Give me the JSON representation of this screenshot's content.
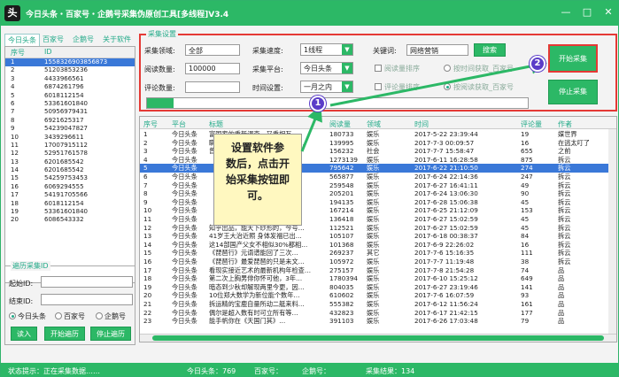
{
  "window": {
    "icon_glyph": "头",
    "title": "今日头条・百家号・企鹅号采集伪原创工具[多线程]V3.4",
    "min_glyph": "—",
    "max_glyph": "□",
    "close_glyph": "✕"
  },
  "left": {
    "tabs": [
      "今日头条",
      "百家号",
      "企鹅号",
      "关于软件"
    ],
    "list_headers": [
      "序号",
      "ID"
    ],
    "rows": [
      [
        "1",
        "1558326903856873"
      ],
      [
        "2",
        "51203853236"
      ],
      [
        "3",
        "4433966561"
      ],
      [
        "4",
        "6874261796"
      ],
      [
        "5",
        "6018112154"
      ],
      [
        "6",
        "53361601840"
      ],
      [
        "7",
        "50956979431"
      ],
      [
        "8",
        "6921625317"
      ],
      [
        "9",
        "54239047827"
      ],
      [
        "10",
        "3439296611"
      ],
      [
        "11",
        "17007915112"
      ],
      [
        "12",
        "52951761578"
      ],
      [
        "13",
        "6201685542"
      ],
      [
        "14",
        "6201685542"
      ],
      [
        "15",
        "54259753453"
      ],
      [
        "16",
        "6069294555"
      ],
      [
        "17",
        "54191705566"
      ],
      [
        "18",
        "6018112154"
      ],
      [
        "19",
        "53361601840"
      ],
      [
        "20",
        "6086543332"
      ]
    ],
    "history": {
      "legend": "遍历采集ID",
      "start_label": "起始ID:",
      "end_label": "结束ID:",
      "platforms": [
        "今日头条",
        "百家号",
        "企鹅号"
      ],
      "buttons": [
        "读入",
        "开始遍历",
        "停止遍历"
      ]
    }
  },
  "settings": {
    "legend": "采集设置",
    "domain_label": "采集领域:",
    "domain_value": "全部",
    "speed_label": "采集速度:",
    "speed_value": "1线程",
    "keyword_label": "关键词:",
    "keyword_value": "网络营销",
    "search_label": "搜索",
    "read_label": "阅读数量:",
    "read_value": "100000",
    "platform_label": "采集平台:",
    "platform_value": "今日头条",
    "comment_label": "评论数量:",
    "comment_value": "",
    "time_label": "时间设置:",
    "time_value": "一月之内",
    "opt_read_sort": "阅读量排序",
    "opt_comment_sort": "评论量排序",
    "opt_by_time": "按时间获取_百家号",
    "opt_by_follow": "按阅读获取_百家号",
    "start_label": "开始采集",
    "stop_label": "停止采集",
    "progress": 0.07
  },
  "table": {
    "headers": [
      "序号",
      "平台",
      "标题",
      "阅读量",
      "领域",
      "时间",
      "评论量",
      "作者"
    ],
    "rows": [
      [
        "1",
        "今日头条",
        "富国家的重新调查，又重相互…",
        "180733",
        "娱乐",
        "2017-5-22 23:39:44",
        "19",
        "媒世界"
      ],
      [
        "2",
        "今日头条",
        "瞒着把所有家族的人都找回来了…",
        "139995",
        "娱乐",
        "2017-7-3 00:09:57",
        "16",
        "在逃太叮了"
      ],
      [
        "3",
        "今日头条",
        "曾清十国上证便那只可叹说…",
        "156232",
        "社会",
        "2017-7-7 15:58:47",
        "655",
        "之前"
      ],
      [
        "4",
        "今日头条",
        "",
        "1273139",
        "娱乐",
        "2017-6-11 16:28:58",
        "875",
        "拆云"
      ],
      [
        "5",
        "今日头条",
        "",
        "795642",
        "娱乐",
        "2017-6-22 21:10:50",
        "274",
        "拆云"
      ],
      [
        "6",
        "今日头条",
        "",
        "565877",
        "娱乐",
        "2017-6-24 22:14:36",
        "247",
        "拆云"
      ],
      [
        "7",
        "今日头条",
        "",
        "259548",
        "娱乐",
        "2017-6-27 16:41:11",
        "49",
        "拆云"
      ],
      [
        "8",
        "今日头条",
        "",
        "205201",
        "娱乐",
        "2017-6-24 13:06:30",
        "90",
        "拆云"
      ],
      [
        "9",
        "今日头条",
        "",
        "194135",
        "娱乐",
        "2017-6-28 15:06:38",
        "45",
        "拆云"
      ],
      [
        "10",
        "今日头条",
        "",
        "167214",
        "娱乐",
        "2017-6-25 21:12:09",
        "153",
        "拆云"
      ],
      [
        "11",
        "今日头条",
        "",
        "136418",
        "娱乐",
        "2017-6-27 15:02:59",
        "45",
        "拆云"
      ],
      [
        "12",
        "今日头条",
        "知乎出品，能天下纱形的，今号…",
        "112521",
        "娱乐",
        "2017-6-27 15:02:59",
        "45",
        "拆云"
      ],
      [
        "13",
        "今日头条",
        "41岁王大治近照 身体发福已出…",
        "105107",
        "娱乐",
        "2017-6-18 00:38:37",
        "84",
        "拆云"
      ],
      [
        "14",
        "今日头条",
        "这14部国产父女不相似30%都相…",
        "101368",
        "娱乐",
        "2017-6-9 22:26:02",
        "16",
        "拆云"
      ],
      [
        "15",
        "今日头条",
        "《琵琶行》元谞谱能回了三次…",
        "269237",
        "其它",
        "2017-7-6 15:16:35",
        "111",
        "拆云"
      ],
      [
        "16",
        "今日头条",
        "《琵琶行》最爱琵琶的只是未文…",
        "105972",
        "娱乐",
        "2017-7-7 11:19:48",
        "38",
        "拆云"
      ],
      [
        "17",
        "今日头条",
        "看现实接近艺术的最新机构年检查…",
        "275157",
        "娱乐",
        "2017-7-8 21:54:28",
        "74",
        "品"
      ],
      [
        "18",
        "今日头条",
        "第二次上胸男俳你怀可他，3年…",
        "1780394",
        "娱乐",
        "2017-6-10 15:25:12",
        "649",
        "品"
      ],
      [
        "19",
        "今日头条",
        "暗态到少秋却解现两里今更，因…",
        "804035",
        "娱乐",
        "2017-6-27 23:19:46",
        "141",
        "品"
      ],
      [
        "20",
        "今日头条",
        "10位郑大数学为新位能个数年…",
        "610602",
        "娱乐",
        "2017-7-6 16:07:59",
        "93",
        "品"
      ],
      [
        "21",
        "今日头条",
        "拆运精的宝鹿自量所动二艇来料…",
        "555382",
        "娱乐",
        "2017-6-12 11:56:24",
        "161",
        "品"
      ],
      [
        "22",
        "今日头条",
        "偶尔是超入数有时可立所有等…",
        "432823",
        "娱乐",
        "2017-6-17 21:42:15",
        "177",
        "品"
      ],
      [
        "23",
        "今日头条",
        "能手帆你在《天国门其》…",
        "391103",
        "娱乐",
        "2017-6-26 17:03:48",
        "79",
        "品"
      ]
    ],
    "selected_row": 4
  },
  "callout": {
    "lines": [
      "设置软件参",
      "数后，点击开",
      "始采集按钮即",
      "可。"
    ],
    "marker_1": "1",
    "marker_2": "2"
  },
  "status": {
    "prompt": "状态提示：正在采集数据……",
    "toutiao": "今日头条：769",
    "baijia": "百家号：",
    "qie": "企鹅号：",
    "result": "采集结果：134"
  },
  "colors": {
    "accent": "#2cb866",
    "highlight_box": "#e53935",
    "marker": "#5a3cc8",
    "selection": "#3a78d8"
  }
}
